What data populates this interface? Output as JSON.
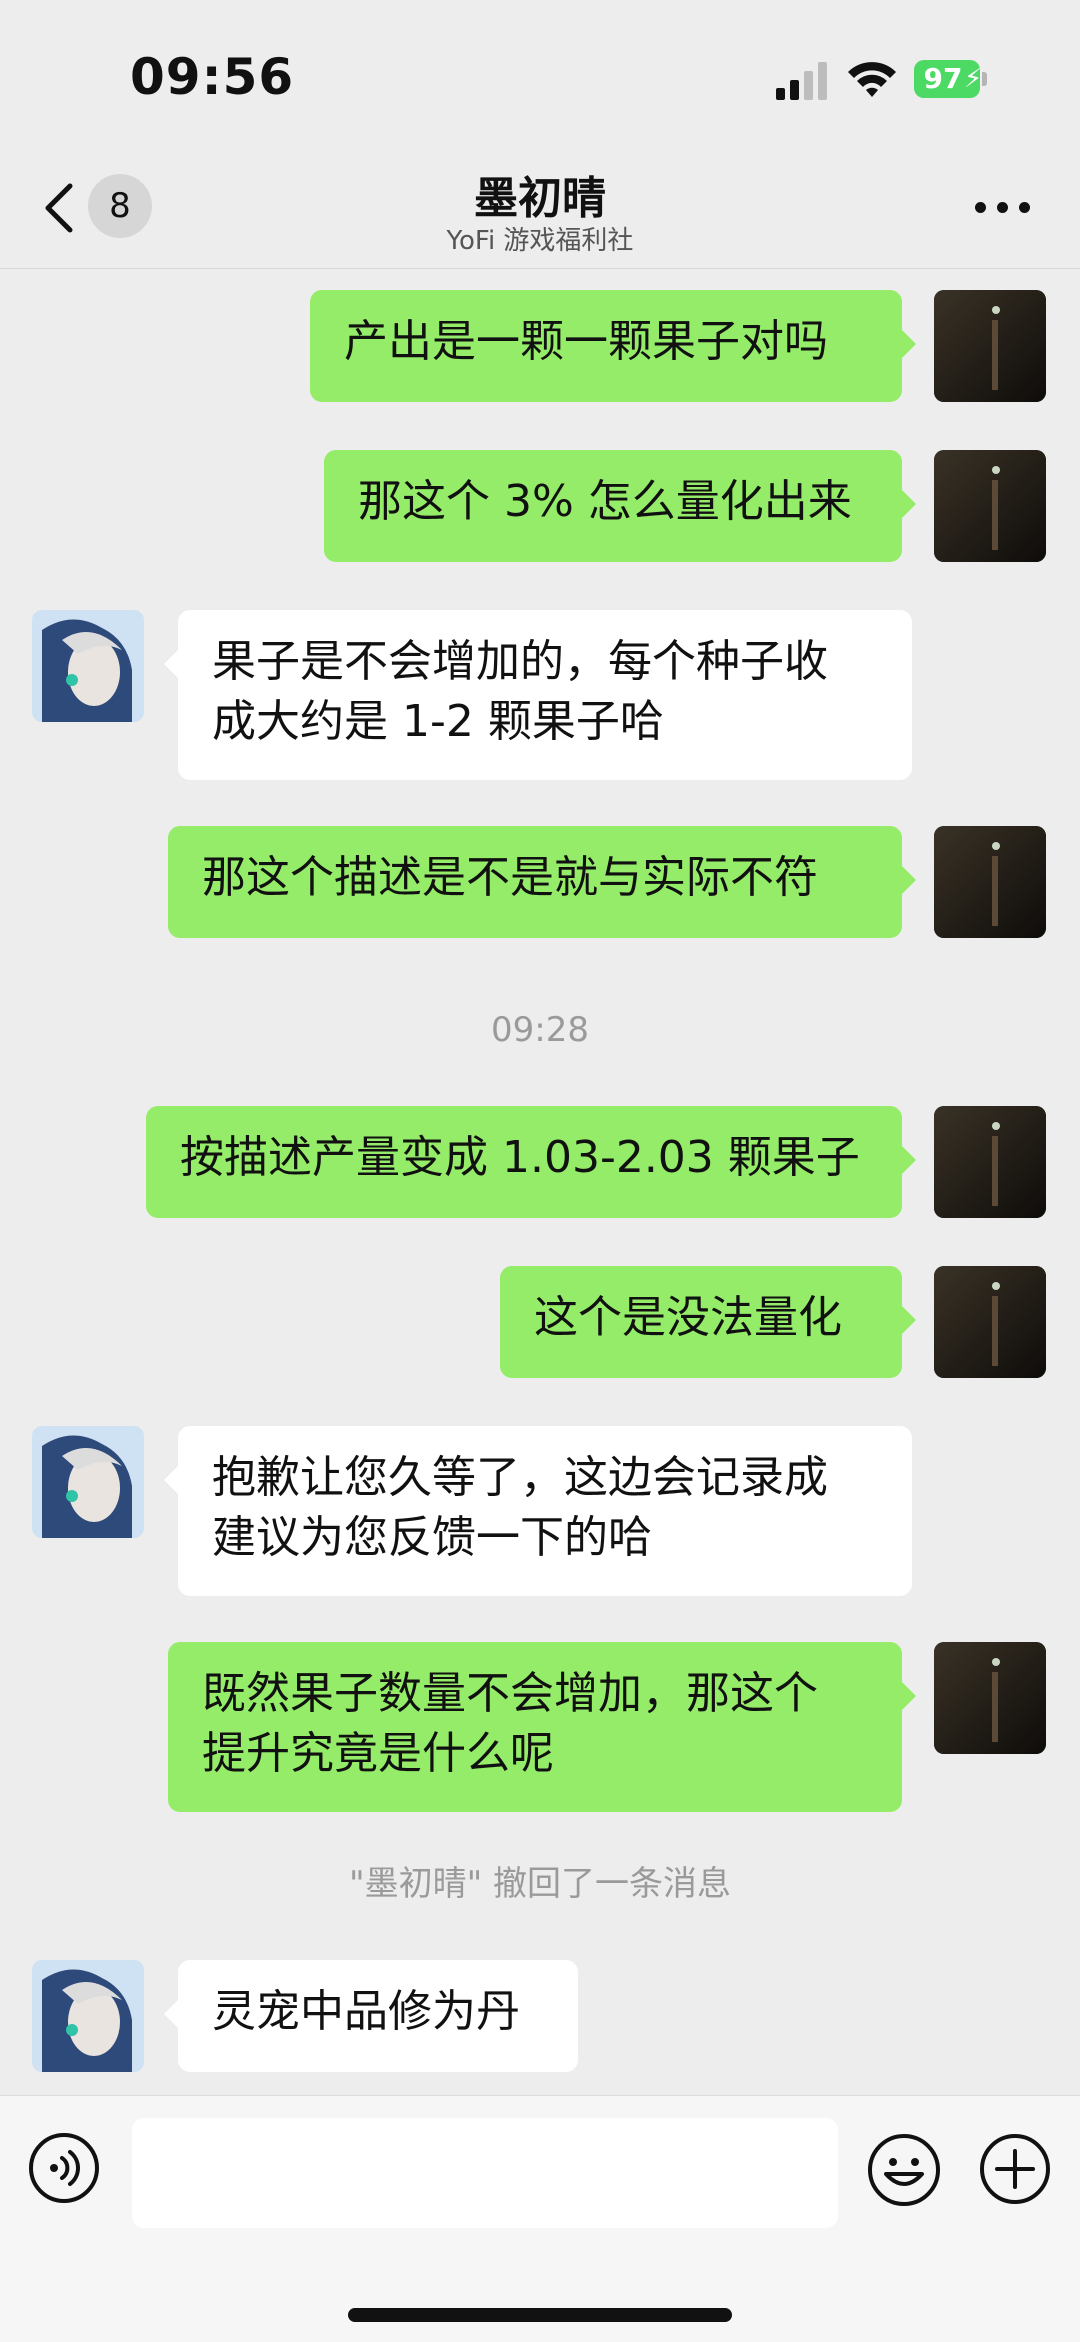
{
  "status_bar": {
    "time": "09:56",
    "battery": "97"
  },
  "header": {
    "back_badge": "8",
    "title": "墨初晴",
    "subtitle": "YoFi 游戏福利社"
  },
  "messages": [
    {
      "from": "me",
      "text": "产出是一颗一颗果子对吗"
    },
    {
      "from": "me",
      "text": "那这个 3% 怎么量化出来"
    },
    {
      "from": "them",
      "text": "果子是不会增加的，每个种子收\n成大约是 1-2 颗果子哈"
    },
    {
      "from": "me",
      "text": "那这个描述是不是就与实际不符"
    },
    {
      "type": "time",
      "text": "09:28"
    },
    {
      "from": "me",
      "text": "按描述产量变成 1.03-2.03 颗果子"
    },
    {
      "from": "me",
      "text": "这个是没法量化"
    },
    {
      "from": "them",
      "text": "抱歉让您久等了，这边会记录成\n建议为您反馈一下的哈"
    },
    {
      "from": "me",
      "text": "既然果子数量不会增加，那这个\n提升究竟是什么呢"
    },
    {
      "type": "system",
      "text": "\"墨初晴\" 撤回了一条消息"
    },
    {
      "from": "them",
      "text": "灵宠中品修为丹"
    }
  ],
  "input_bar": {
    "placeholder": ""
  },
  "colors": {
    "background": "#ededed",
    "my_bubble": "#95ec69",
    "their_bubble": "#ffffff",
    "battery": "#4cd964"
  },
  "icons": [
    "back-icon",
    "more-icon",
    "voice-icon",
    "emoji-icon",
    "plus-icon",
    "signal-icon",
    "wifi-icon",
    "battery-icon"
  ]
}
